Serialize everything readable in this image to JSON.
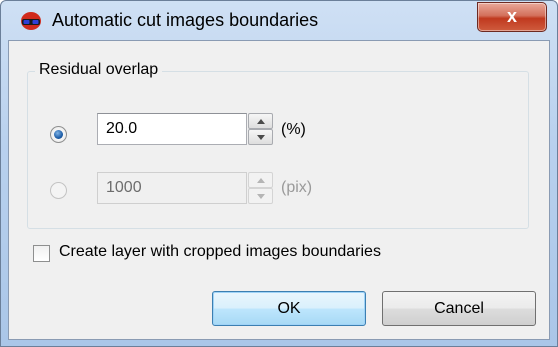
{
  "window": {
    "title": "Automatic cut images boundaries",
    "close_label": "x"
  },
  "group": {
    "label": "Residual overlap"
  },
  "percent_option": {
    "selected": true,
    "value": "20.0",
    "unit": "(%)"
  },
  "pix_option": {
    "selected": false,
    "value": "1000",
    "unit": "(pix)"
  },
  "checkbox": {
    "checked": false,
    "label": "Create layer with cropped images boundaries"
  },
  "buttons": {
    "ok_label": "OK",
    "cancel_label": "Cancel"
  },
  "colors": {
    "accent": "#3c7fb1",
    "close_red": "#c0391f",
    "dialog_bg": "#f0f0f0"
  },
  "icons": {
    "app": "red-3d-glasses-icon",
    "close": "close-icon",
    "spin_up": "spin-up-arrow-icon",
    "spin_down": "spin-down-arrow-icon"
  }
}
